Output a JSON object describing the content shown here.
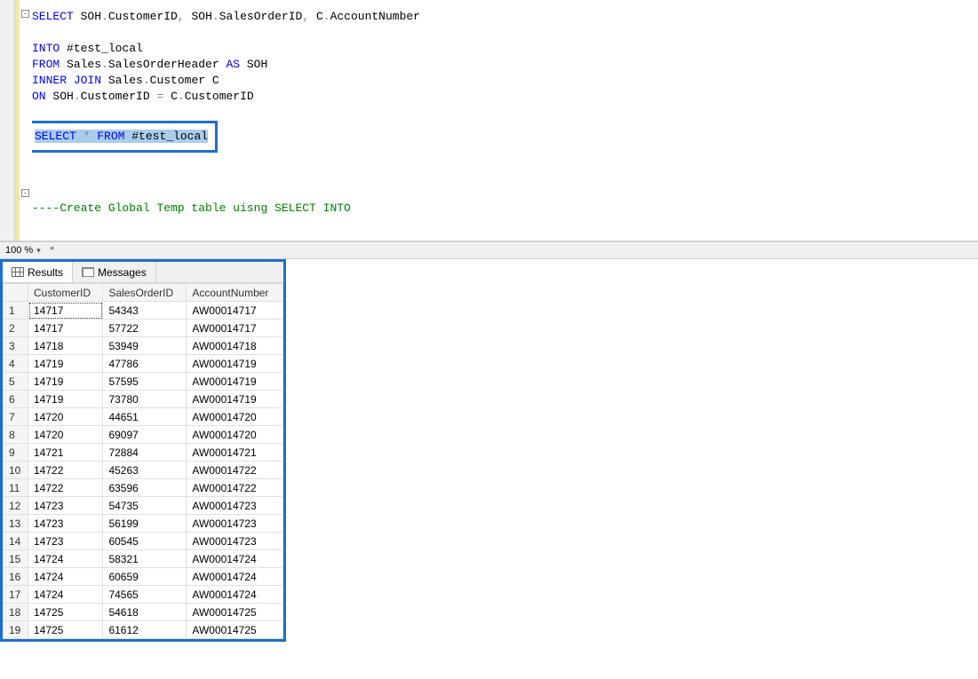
{
  "editor": {
    "zoom": "100 %",
    "line1": {
      "kw1": "SELECT",
      "t1": " SOH",
      "op1": ".",
      "t2": "CustomerID",
      "op2": ",",
      "t3": " SOH",
      "op3": ".",
      "t4": "SalesOrderID",
      "op4": ",",
      "t5": " C",
      "op5": ".",
      "t6": "AccountNumber"
    },
    "line3": {
      "kw1": "INTO",
      "t1": " #test_local"
    },
    "line4": {
      "kw1": "FROM",
      "t1": " Sales",
      "op1": ".",
      "t2": "SalesOrderHeader ",
      "kw2": "AS",
      "t3": " SOH"
    },
    "line5": {
      "kw1": "INNER",
      "kw2": " JOIN",
      "t1": " Sales",
      "op1": ".",
      "t2": "Customer C"
    },
    "line6": {
      "kw1": "ON",
      "t1": " SOH",
      "op1": ".",
      "t2": "CustomerID ",
      "op2": "=",
      "t3": " C",
      "op3": ".",
      "t4": "CustomerID"
    },
    "line8": {
      "kw1": "SELECT",
      "op1": " * ",
      "kw2": "FROM",
      "t1": " #test_local"
    },
    "comment": "----Create Global Temp table uisng SELECT INTO"
  },
  "tabs": {
    "results": "Results",
    "messages": "Messages"
  },
  "grid": {
    "headers": [
      "CustomerID",
      "SalesOrderID",
      "AccountNumber"
    ],
    "rows": [
      {
        "n": "1",
        "c0": "14717",
        "c1": "54343",
        "c2": "AW00014717"
      },
      {
        "n": "2",
        "c0": "14717",
        "c1": "57722",
        "c2": "AW00014717"
      },
      {
        "n": "3",
        "c0": "14718",
        "c1": "53949",
        "c2": "AW00014718"
      },
      {
        "n": "4",
        "c0": "14719",
        "c1": "47786",
        "c2": "AW00014719"
      },
      {
        "n": "5",
        "c0": "14719",
        "c1": "57595",
        "c2": "AW00014719"
      },
      {
        "n": "6",
        "c0": "14719",
        "c1": "73780",
        "c2": "AW00014719"
      },
      {
        "n": "7",
        "c0": "14720",
        "c1": "44651",
        "c2": "AW00014720"
      },
      {
        "n": "8",
        "c0": "14720",
        "c1": "69097",
        "c2": "AW00014720"
      },
      {
        "n": "9",
        "c0": "14721",
        "c1": "72884",
        "c2": "AW00014721"
      },
      {
        "n": "10",
        "c0": "14722",
        "c1": "45263",
        "c2": "AW00014722"
      },
      {
        "n": "11",
        "c0": "14722",
        "c1": "63596",
        "c2": "AW00014722"
      },
      {
        "n": "12",
        "c0": "14723",
        "c1": "54735",
        "c2": "AW00014723"
      },
      {
        "n": "13",
        "c0": "14723",
        "c1": "56199",
        "c2": "AW00014723"
      },
      {
        "n": "14",
        "c0": "14723",
        "c1": "60545",
        "c2": "AW00014723"
      },
      {
        "n": "15",
        "c0": "14724",
        "c1": "58321",
        "c2": "AW00014724"
      },
      {
        "n": "16",
        "c0": "14724",
        "c1": "60659",
        "c2": "AW00014724"
      },
      {
        "n": "17",
        "c0": "14724",
        "c1": "74565",
        "c2": "AW00014724"
      },
      {
        "n": "18",
        "c0": "14725",
        "c1": "54618",
        "c2": "AW00014725"
      },
      {
        "n": "19",
        "c0": "14725",
        "c1": "61612",
        "c2": "AW00014725"
      }
    ]
  }
}
